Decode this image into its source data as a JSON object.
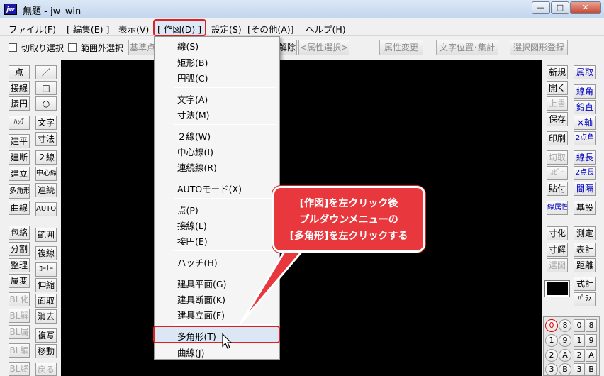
{
  "window": {
    "title": "無題 - jw_win",
    "app_icon": "jw",
    "min": "—",
    "max": "□",
    "close": "✕"
  },
  "menubar": [
    "ファイル(F)",
    "[ 編集(E) ]",
    "表示(V)",
    "[ 作図(D) ]",
    "設定(S)",
    "[その他(A)]",
    "ヘルプ(H)"
  ],
  "options": {
    "crop_select": "切取り選択",
    "range_outside_select": "範囲外選択",
    "ref_point": "基準点",
    "cancel": "解除",
    "attr_select": "<属性選択>",
    "attr_change": "属性変更",
    "text_pos_total": "文字位置･集計",
    "select_shape_register": "選択図形登録"
  },
  "left_tools_a": [
    "点",
    "接線",
    "接円",
    "ﾊｯﾁ",
    "建平",
    "建断",
    "建立",
    "多角形",
    "曲線",
    "包絡",
    "分割",
    "整理",
    "属変",
    "BL化",
    "BL解",
    "BL属",
    "BL編",
    "BL終"
  ],
  "left_tools_b": [
    "／",
    "□",
    "○",
    "文字",
    "寸法",
    "２線",
    "中心線",
    "連続",
    "AUTO",
    "範囲",
    "複線",
    "ｺｰﾅｰ",
    "伸縮",
    "面取",
    "消去",
    "複写",
    "移動",
    "戻る"
  ],
  "right_tools_a": [
    "新規",
    "開く",
    "上書",
    "保存",
    "印刷",
    "切取",
    "ｺﾋﾟｰ",
    "貼付",
    "線属性",
    "寸化",
    "寸解",
    "選図",
    "式計",
    "ﾊﾟﾗﾒ"
  ],
  "right_tools_b": [
    "属取",
    "線角",
    "鉛直",
    "×軸",
    "2点角",
    "線長",
    "2点長",
    "間隔",
    "基設",
    "測定",
    "表計",
    "距離"
  ],
  "layer_buttons": [
    "0",
    "8",
    "0",
    "8",
    "1",
    "9",
    "1",
    "9",
    "2",
    "A",
    "2",
    "A",
    "3",
    "B",
    "3",
    "B"
  ],
  "dropdown": [
    "線(S)",
    "矩形(B)",
    "円弧(C)",
    "文字(A)",
    "寸法(M)",
    "２線(W)",
    "中心線(I)",
    "連続線(R)",
    "AUTOモード(X)",
    "点(P)",
    "接線(L)",
    "接円(E)",
    "ハッチ(H)",
    "建具平面(G)",
    "建具断面(K)",
    "建具立面(F)",
    "多角形(T)",
    "曲線(J)"
  ],
  "callout": [
    "[作図]を左クリック後",
    "プルダウンメニューの",
    "[多角形]を左クリックする"
  ],
  "colors": {
    "callout": "#e8383d",
    "highlight": "#e02020",
    "canvas": "#000000"
  }
}
